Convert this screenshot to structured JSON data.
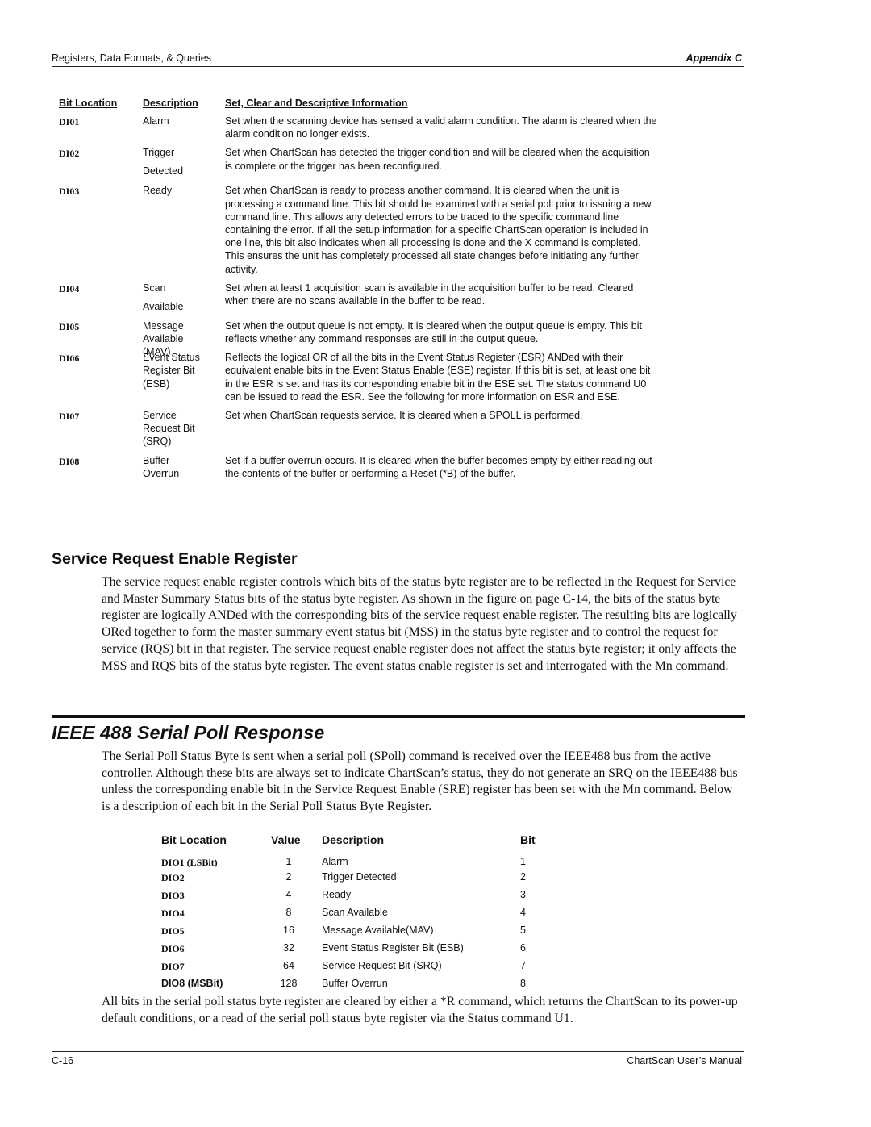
{
  "header": {
    "section": "Registers, Data Formats, & Queries",
    "appendix": "Appendix C"
  },
  "bit_table": {
    "headers": [
      "Bit Location",
      "Description",
      "Set, Clear and Descriptive Information"
    ],
    "rows": [
      {
        "location": "DI01",
        "description": "Alarm",
        "info": "Set when the scanning device has sensed a valid alarm condition.  The alarm is cleared when the alarm condition no longer exists."
      },
      {
        "location": "DI02",
        "description": "Trigger Detected",
        "info": "Set when ChartScan has detected the trigger condition and will be cleared when the acquisition is complete or the trigger has been reconfigured."
      },
      {
        "location": "DI03",
        "description": "Ready",
        "info": "Set when ChartScan is ready to process another command.  It is cleared when the unit is processing a command line.  This bit should be examined with a serial poll prior to issuing a new command line.  This allows any detected errors to be traced to the specific command line containing the error.  If all the setup information for a specific ChartScan operation is included in one line, this bit also indicates when all processing is done and the X command is completed.  This ensures the unit has completely processed all state changes before initiating any further activity."
      },
      {
        "location": "DI04",
        "description": "Scan Available",
        "info": "Set when at least 1 acquisition scan is available in the acquisition buffer to be read.  Cleared when there are no scans available in the buffer to be read."
      },
      {
        "location": "DI05",
        "description": "Message Available (MAV)",
        "info": "Set when the output queue is not empty.  It is cleared when the output queue is empty.  This bit reflects whether any command responses are still in the output queue."
      },
      {
        "location": "DI06",
        "description": "Event Status Register Bit (ESB)",
        "info": "Reflects the logical OR of all the bits in the Event Status Register (ESR) ANDed with their equivalent enable bits in the Event Status Enable (ESE) register.  If this bit is set, at least one bit in the ESR is set and has its corresponding enable bit in the ESE set.  The status command U0 can be issued to read the ESR.  See the following for more information on ESR and ESE."
      },
      {
        "location": "DI07",
        "description": "Service Request Bit (SRQ)",
        "info": "Set when ChartScan requests service.  It is cleared when a SPOLL is performed."
      },
      {
        "location": "DI08",
        "description": "Buffer Overrun",
        "info": "Set if a buffer overrun occurs.  It is cleared when the buffer becomes empty by either reading out the contents of the buffer or performing a Reset (*B) of the buffer."
      }
    ]
  },
  "sre_section": {
    "heading": "Service Request Enable Register",
    "paragraph": "The service request enable register controls which bits of the status byte register are to be reflected in the Request for Service and Master Summary Status bits of the status byte register.  As shown in the figure on page C-14, the bits of the status byte register are logically ANDed with the corresponding bits of the service request enable register.  The resulting bits are logically ORed together to form the master summary event status bit (MSS) in the status byte register and to control the request for service (RQS) bit in that register.  The service request enable register does not affect the status byte register; it only affects the MSS and RQS bits of the status byte register.  The event status enable register is set and interrogated with the Mn command."
  },
  "spoll_section": {
    "heading": "IEEE 488 Serial Poll Response",
    "intro": "The Serial Poll Status Byte is sent when a serial poll (SPoll) command is received over the IEEE488 bus from the active controller.  Although these bits are always set to indicate ChartScan’s status, they do not generate an SRQ on the IEEE488 bus unless the corresponding enable bit in the Service Request Enable (SRE) register has been set with the Mn command.  Below is a description of each bit in the Serial Poll Status Byte Register.",
    "table": {
      "headers": [
        "Bit Location",
        "Value",
        "Description",
        "Bit"
      ],
      "rows": [
        {
          "location": "DIO1 (LSBit)",
          "value": "1",
          "description": "Alarm",
          "bit": "1"
        },
        {
          "location": "DIO2",
          "value": "2",
          "description": "Trigger Detected",
          "bit": "2"
        },
        {
          "location": "DIO3",
          "value": "4",
          "description": "Ready",
          "bit": "3"
        },
        {
          "location": "DIO4",
          "value": "8",
          "description": "Scan Available",
          "bit": "4"
        },
        {
          "location": "DIO5",
          "value": "16",
          "description": "Message Available(MAV)",
          "bit": "5"
        },
        {
          "location": "DIO6",
          "value": "32",
          "description": "Event Status Register Bit (ESB)",
          "bit": "6"
        },
        {
          "location": "DIO7",
          "value": "64",
          "description": "Service Request Bit (SRQ)",
          "bit": "7"
        },
        {
          "location": "DIO8 (MSBit)",
          "value": "128",
          "description": "Buffer Overrun",
          "bit": "8"
        }
      ]
    },
    "closing": "All bits in the serial poll status byte register are cleared by either a *R command, which returns the ChartScan to its power-up default conditions, or a read of the serial poll status byte register via the Status command U1."
  },
  "footer": {
    "page_number": "C-16",
    "manual_title": "ChartScan User’s Manual"
  }
}
